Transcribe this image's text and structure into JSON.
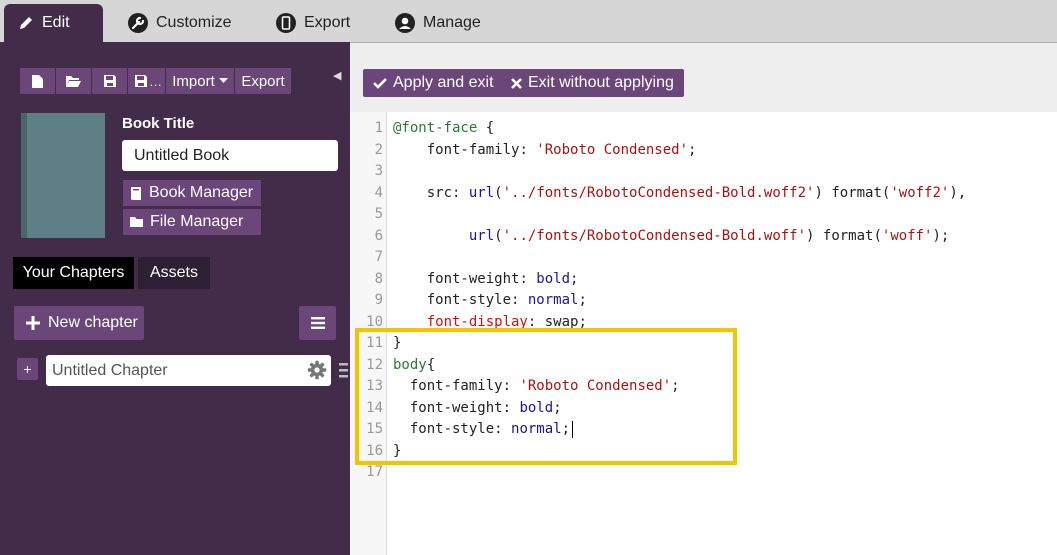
{
  "top_tabs": [
    {
      "label": "Edit",
      "icon": "pencil-icon",
      "active": true
    },
    {
      "label": "Customize",
      "icon": "wrench-icon",
      "active": false
    },
    {
      "label": "Export",
      "icon": "phone-icon",
      "active": false
    },
    {
      "label": "Manage",
      "icon": "user-icon",
      "active": false
    }
  ],
  "toolbar": {
    "import_label": "Import",
    "export_label": "Export",
    "icons": [
      "new-file-icon",
      "open-folder-icon",
      "save-icon",
      "save-as-icon"
    ]
  },
  "book": {
    "title_label": "Book Title",
    "title_value": "Untitled Book",
    "book_manager_label": "Book Manager",
    "file_manager_label": "File Manager"
  },
  "chapter_tabs": {
    "your_chapters": "Your Chapters",
    "assets": "Assets"
  },
  "chapters": {
    "new_chapter_label": "New chapter",
    "items": [
      {
        "title": "Untitled Chapter"
      }
    ]
  },
  "actions": {
    "apply_label": "Apply and exit",
    "exit_label": "Exit without applying"
  },
  "editor": {
    "line_numbers": [
      "1",
      "2",
      "3",
      "4",
      "5",
      "6",
      "7",
      "8",
      "9",
      "10",
      "11",
      "12",
      "13",
      "14",
      "15",
      "16",
      "17"
    ]
  },
  "colors": {
    "sidebar_bg": "#432c4a",
    "button_bg": "#6b4779",
    "highlight_border": "#f5c400"
  }
}
